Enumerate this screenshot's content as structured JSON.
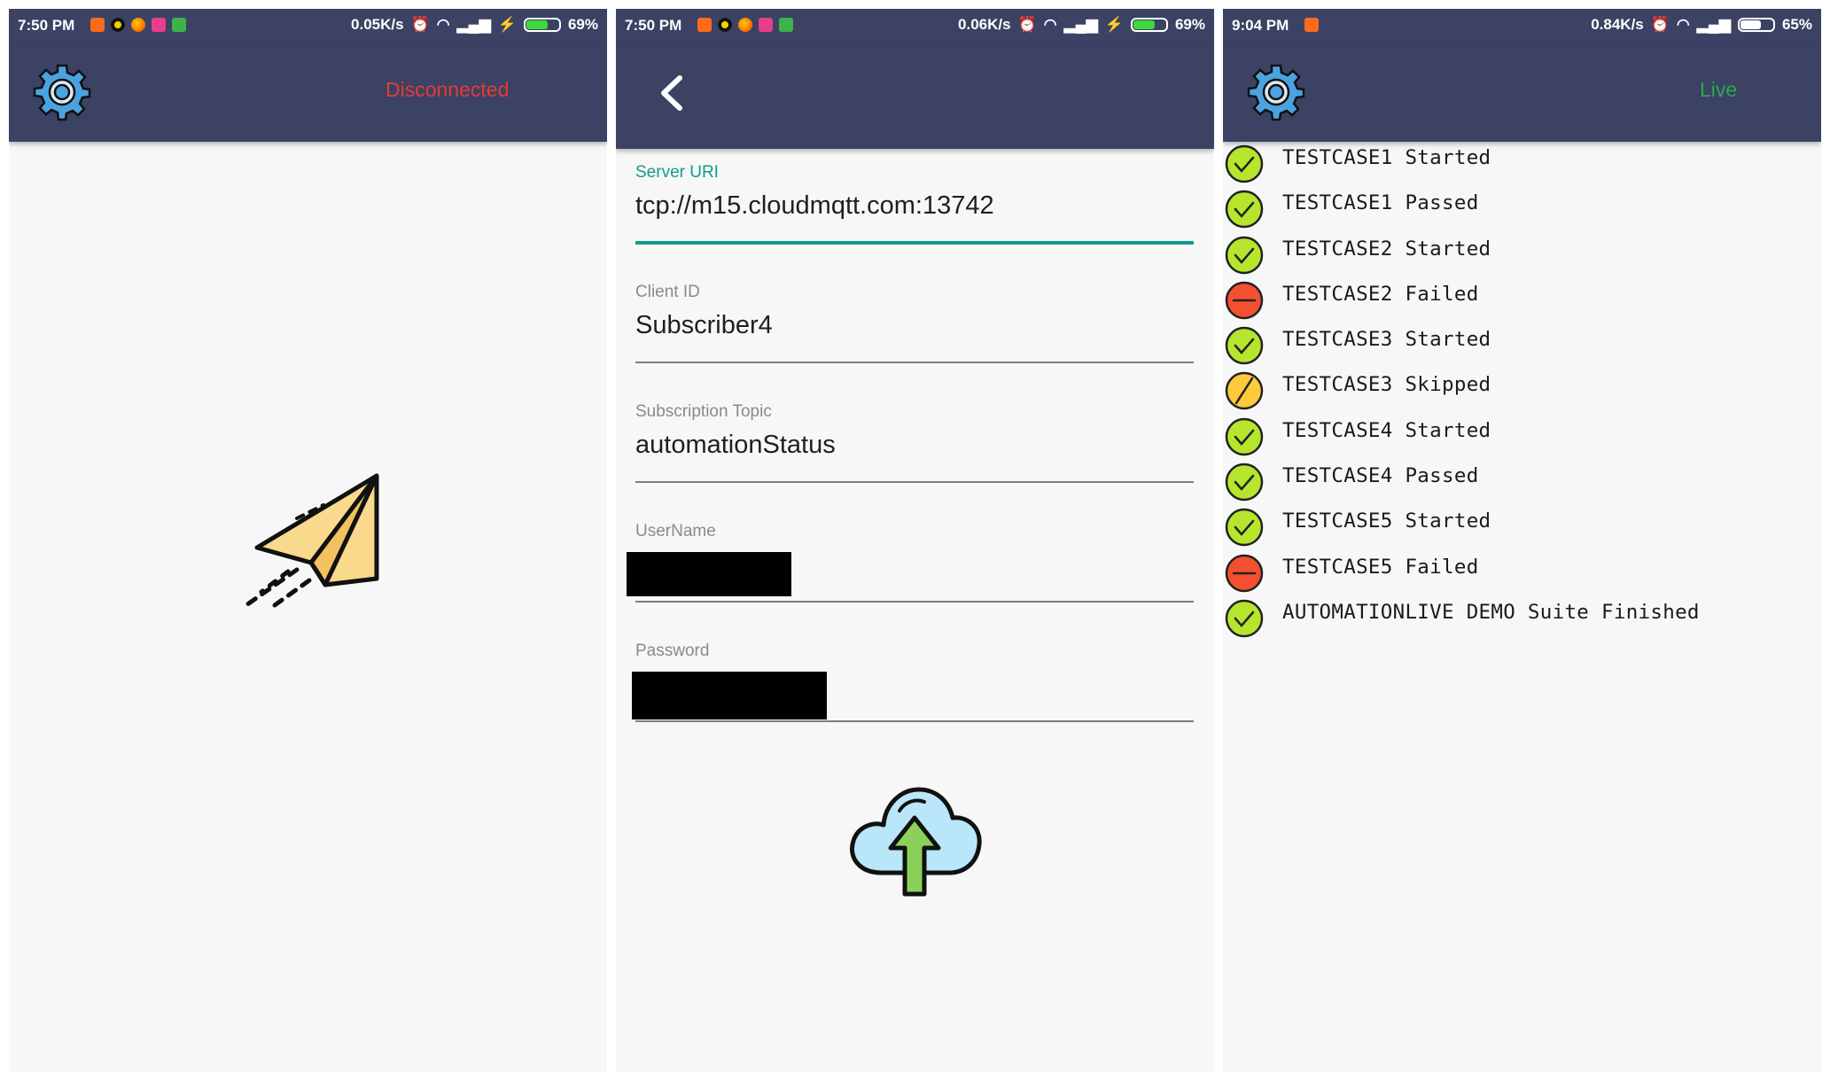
{
  "screens": [
    {
      "statusbar": {
        "time": "7:50 PM",
        "speed": "0.05K/s",
        "battery": "69%",
        "battery_level": 0.69
      },
      "appbar": {
        "status": "Disconnected",
        "status_color": "#e53935",
        "settings_icon": "gear-icon"
      },
      "illustration": "paper-plane-icon"
    },
    {
      "statusbar": {
        "time": "7:50 PM",
        "speed": "0.06K/s",
        "battery": "69%",
        "battery_level": 0.69
      },
      "appbar": {
        "back_icon": "chevron-left-icon"
      },
      "form": {
        "server_uri": {
          "label": "Server URI",
          "value": "tcp://m15.cloudmqtt.com:13742"
        },
        "client_id": {
          "label": "Client ID",
          "value": "Subscriber4"
        },
        "topic": {
          "label": "Subscription Topic",
          "value": "automationStatus"
        },
        "username": {
          "label": "UserName"
        },
        "password": {
          "label": "Password"
        }
      },
      "connect_icon": "cloud-upload-icon"
    },
    {
      "statusbar": {
        "time": "9:04 PM",
        "speed": "0.84K/s",
        "battery": "65%",
        "battery_level": 0.65
      },
      "appbar": {
        "status": "Live",
        "status_color": "#2ea84a",
        "settings_icon": "gear-icon"
      },
      "log": [
        {
          "status": "passed",
          "text": "TESTCASE1 Started"
        },
        {
          "status": "passed",
          "text": "TESTCASE1 Passed"
        },
        {
          "status": "passed",
          "text": "TESTCASE2 Started"
        },
        {
          "status": "failed",
          "text": "TESTCASE2 Failed"
        },
        {
          "status": "passed",
          "text": "TESTCASE3 Started"
        },
        {
          "status": "skipped",
          "text": "TESTCASE3 Skipped"
        },
        {
          "status": "passed",
          "text": "TESTCASE4 Started"
        },
        {
          "status": "passed",
          "text": "TESTCASE4 Passed"
        },
        {
          "status": "passed",
          "text": "TESTCASE5 Started"
        },
        {
          "status": "failed",
          "text": "TESTCASE5 Failed"
        },
        {
          "status": "passed",
          "text": "AUTOMATIONLIVE DEMO Suite Finished"
        }
      ]
    }
  ],
  "colors": {
    "header": "#3b4264",
    "accent": "#129a8a",
    "passed": "#b5e62d",
    "failed": "#f4502f",
    "skipped": "#ffc93c"
  }
}
